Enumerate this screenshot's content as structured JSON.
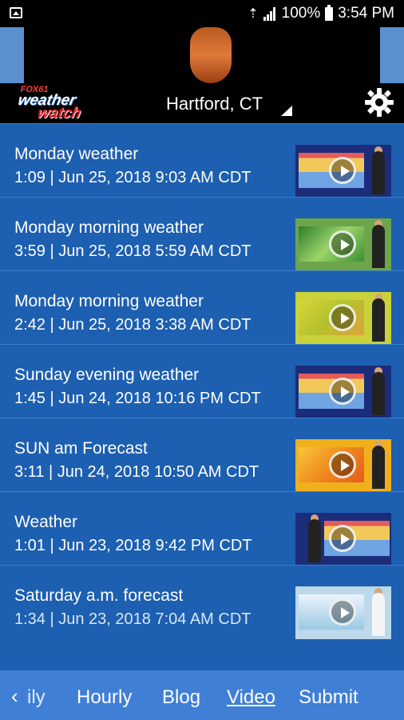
{
  "status": {
    "battery": "100%",
    "time": "3:54 PM"
  },
  "header": {
    "brand_top": "FOX61",
    "brand_mid": "weather",
    "brand_bottom": "watch",
    "location": "Hartford, CT"
  },
  "videos": [
    {
      "title": "Monday weather",
      "meta": "1:09 | Jun 25, 2018 9:03 AM CDT",
      "thumb_style": "forecast"
    },
    {
      "title": "Monday morning weather",
      "meta": "3:59 | Jun 25, 2018 5:59 AM CDT",
      "thumb_style": "radar"
    },
    {
      "title": "Monday morning weather",
      "meta": "2:42 | Jun 25, 2018 3:38 AM CDT",
      "thumb_style": "map"
    },
    {
      "title": "Sunday evening weather",
      "meta": "1:45 | Jun 24, 2018 10:16 PM CDT",
      "thumb_style": "forecast"
    },
    {
      "title": "SUN am Forecast",
      "meta": "3:11 | Jun 24, 2018 10:50 AM CDT",
      "thumb_style": "heat"
    },
    {
      "title": "Weather",
      "meta": "1:01 | Jun 23, 2018 9:42 PM CDT",
      "thumb_style": "forecast"
    },
    {
      "title": "Saturday a.m. forecast",
      "meta": "1:34 | Jun 23, 2018 7:04 AM CDT",
      "thumb_style": "studio"
    }
  ],
  "bottom_nav": {
    "partial": "ily",
    "items": [
      "Hourly",
      "Blog",
      "Video",
      "Submit"
    ],
    "active": "Video"
  },
  "colors": {
    "background": "#1d5fb0",
    "header": "#000000",
    "bottom_nav": "#3f7fd6",
    "accent_red": "#e11b22"
  }
}
